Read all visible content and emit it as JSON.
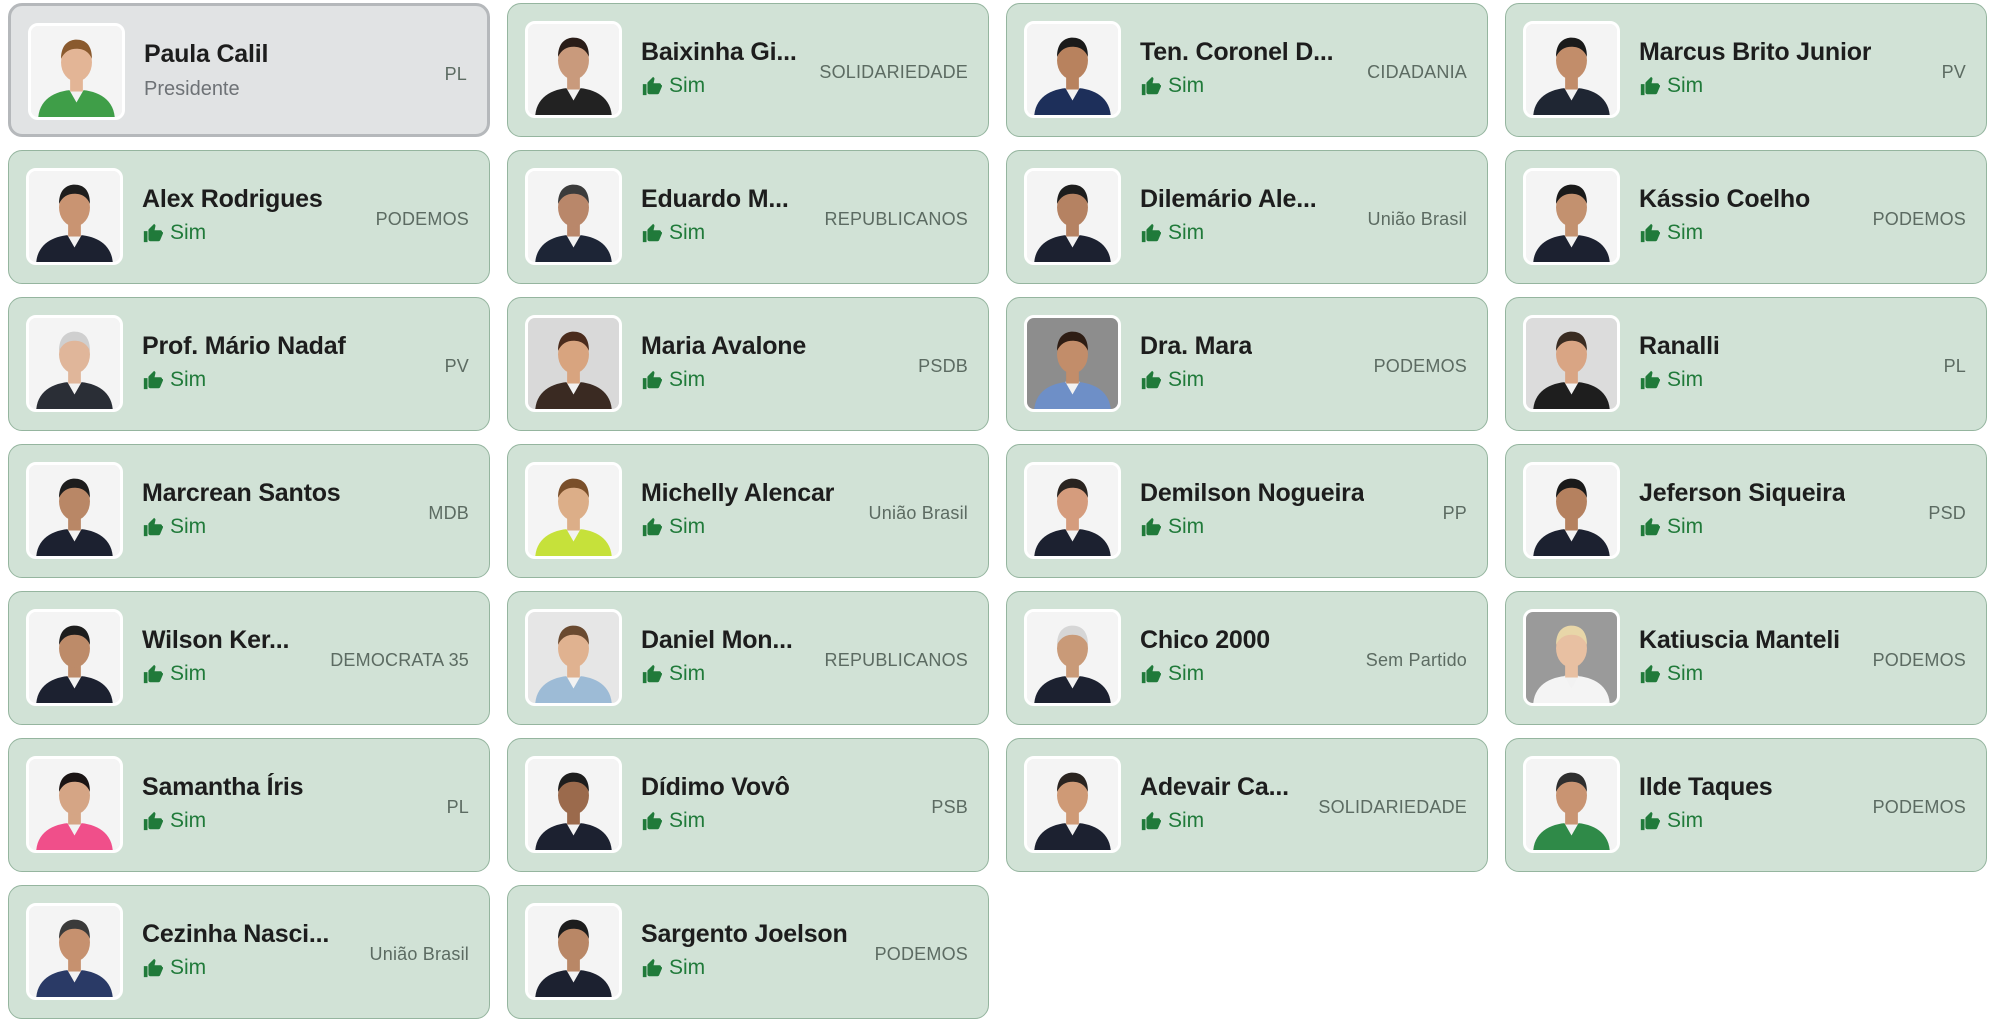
{
  "colors": {
    "card_bg": "#d1e2d6",
    "card_border": "#95b59f",
    "presidente_bg": "#e1e3e4",
    "vote_green": "#207a3a"
  },
  "members": [
    {
      "name": "Paula Calil",
      "party": "PL",
      "role": "Presidente",
      "vote": null,
      "skin": "#e3b596",
      "hair": "#8a5a2e",
      "shirt": "#3f9e48",
      "bg": "#f4f4f4"
    },
    {
      "name": "Baixinha Gi...",
      "party": "SOLIDARIEDADE",
      "vote": "Sim",
      "skin": "#c99a7c",
      "hair": "#2a1d18",
      "shirt": "#222222",
      "bg": "#f4f4f4"
    },
    {
      "name": "Ten. Coronel D...",
      "party": "CIDADANIA",
      "vote": "Sim",
      "skin": "#b8825e",
      "hair": "#1a1a1a",
      "shirt": "#1d2f5a",
      "bg": "#f4f4f4"
    },
    {
      "name": "Marcus Brito Junior",
      "party": "PV",
      "vote": "Sim",
      "skin": "#c28d6a",
      "hair": "#1a1a1a",
      "shirt": "#1f2633",
      "bg": "#f4f4f4"
    },
    {
      "name": "Alex Rodrigues",
      "party": "PODEMOS",
      "vote": "Sim",
      "skin": "#c99472",
      "hair": "#1d1d1d",
      "shirt": "#1c2130",
      "bg": "#f4f4f4"
    },
    {
      "name": "Eduardo M...",
      "party": "REPUBLICANOS",
      "vote": "Sim",
      "skin": "#b9876a",
      "hair": "#3b3b3b",
      "shirt": "#1d2536",
      "bg": "#f4f4f4"
    },
    {
      "name": "Dilemário Ale...",
      "party": "União Brasil",
      "vote": "Sim",
      "skin": "#b58262",
      "hair": "#1d1d1d",
      "shirt": "#1c2130",
      "bg": "#f4f4f4"
    },
    {
      "name": "Kássio Coelho",
      "party": "PODEMOS",
      "vote": "Sim",
      "skin": "#c3916f",
      "hair": "#1a1a1a",
      "shirt": "#1c2130",
      "bg": "#f4f4f4"
    },
    {
      "name": "Prof. Mário Nadaf",
      "party": "PV",
      "vote": "Sim",
      "skin": "#e0b69a",
      "hair": "#cfcfcf",
      "shirt": "#2a2e36",
      "bg": "#f4f4f4"
    },
    {
      "name": "Maria Avalone",
      "party": "PSDB",
      "vote": "Sim",
      "skin": "#d8a47f",
      "hair": "#4a2b1c",
      "shirt": "#3a2a22",
      "bg": "#d9d9d9"
    },
    {
      "name": "Dra. Mara",
      "party": "PODEMOS",
      "vote": "Sim",
      "skin": "#c28d6a",
      "hair": "#2e1d14",
      "shirt": "#6e8fc7",
      "bg": "#8d8d8d"
    },
    {
      "name": "Ranalli",
      "party": "PL",
      "vote": "Sim",
      "skin": "#d9a584",
      "hair": "#3a2c22",
      "shirt": "#1e1e1e",
      "bg": "#dcdcdc"
    },
    {
      "name": "Marcrean Santos",
      "party": "MDB",
      "vote": "Sim",
      "skin": "#b98766",
      "hair": "#1d1d1d",
      "shirt": "#1c2130",
      "bg": "#f4f4f4"
    },
    {
      "name": "Michelly Alencar",
      "party": "União Brasil",
      "vote": "Sim",
      "skin": "#dcae88",
      "hair": "#7a4f2a",
      "shirt": "#c6e13a",
      "bg": "#f4f4f4"
    },
    {
      "name": "Demilson Nogueira",
      "party": "PP",
      "vote": "Sim",
      "skin": "#d59c7d",
      "hair": "#2a2420",
      "shirt": "#1c2130",
      "bg": "#f4f4f4"
    },
    {
      "name": "Jeferson Siqueira",
      "party": "PSD",
      "vote": "Sim",
      "skin": "#b5815f",
      "hair": "#1a1a1a",
      "shirt": "#1c2130",
      "bg": "#f4f4f4"
    },
    {
      "name": "Wilson Ker...",
      "party": "DEMOCRATA 35",
      "vote": "Sim",
      "skin": "#bd8b69",
      "hair": "#1d1d1d",
      "shirt": "#1c2130",
      "bg": "#f4f4f4"
    },
    {
      "name": "Daniel Mon...",
      "party": "REPUBLICANOS",
      "vote": "Sim",
      "skin": "#e0b290",
      "hair": "#6a4a30",
      "shirt": "#9dbbd6",
      "bg": "#e6e6e6"
    },
    {
      "name": "Chico 2000",
      "party": "Sem Partido",
      "vote": "Sim",
      "skin": "#c99a78",
      "hair": "#d6d6d6",
      "shirt": "#1c2130",
      "bg": "#f4f4f4"
    },
    {
      "name": "Katiuscia Manteli",
      "party": "PODEMOS",
      "vote": "Sim",
      "skin": "#e8c0a2",
      "hair": "#e8d6a8",
      "shirt": "#f4f4f4",
      "bg": "#9a9a9a"
    },
    {
      "name": "Samantha Íris",
      "party": "PL",
      "vote": "Sim",
      "skin": "#d5a585",
      "hair": "#1a1414",
      "shirt": "#f04f8a",
      "bg": "#f4f4f4"
    },
    {
      "name": "Dídimo Vovô",
      "party": "PSB",
      "vote": "Sim",
      "skin": "#9b6a4c",
      "hair": "#1d1d1d",
      "shirt": "#1c2130",
      "bg": "#f4f4f4"
    },
    {
      "name": "Adevair Ca...",
      "party": "SOLIDARIEDADE",
      "vote": "Sim",
      "skin": "#cf9a76",
      "hair": "#2a2420",
      "shirt": "#1c2130",
      "bg": "#f4f4f4"
    },
    {
      "name": "Ilde Taques",
      "party": "PODEMOS",
      "vote": "Sim",
      "skin": "#c99472",
      "hair": "#2e2e2e",
      "shirt": "#2f8a48",
      "bg": "#f4f4f4"
    },
    {
      "name": "Cezinha Nasci...",
      "party": "União Brasil",
      "vote": "Sim",
      "skin": "#c6916f",
      "hair": "#3a3a3a",
      "shirt": "#2a3a66",
      "bg": "#f4f4f4"
    },
    {
      "name": "Sargento Joelson",
      "party": "PODEMOS",
      "vote": "Sim",
      "skin": "#b98766",
      "hair": "#1d1d1d",
      "shirt": "#1c2130",
      "bg": "#f4f4f4"
    }
  ]
}
